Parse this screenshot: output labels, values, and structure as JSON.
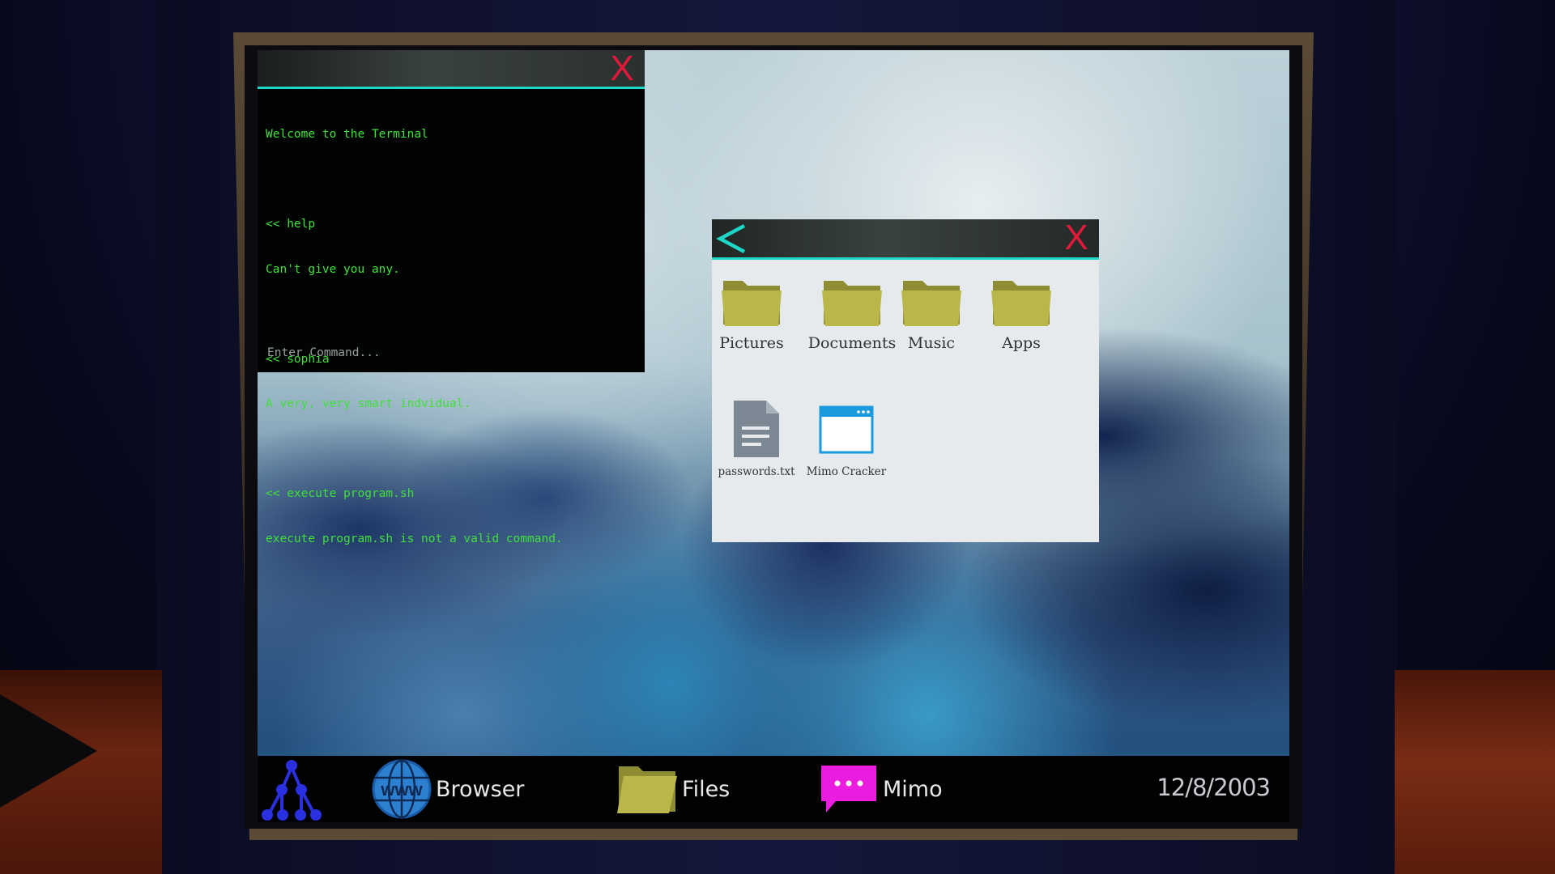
{
  "terminal": {
    "close_label": "X",
    "lines": [
      "Welcome to the Terminal",
      "",
      "<< help",
      "Can't give you any.",
      "",
      "<< sophia",
      "A very, very smart indvidual.",
      "",
      "<< execute program.sh",
      "execute program.sh is not a valid command."
    ],
    "input_placeholder": "Enter Command..."
  },
  "explorer": {
    "close_label": "X",
    "items": [
      {
        "label": "Pictures",
        "icon": "folder-icon"
      },
      {
        "label": "Documents",
        "icon": "folder-icon"
      },
      {
        "label": "Music",
        "icon": "folder-icon"
      },
      {
        "label": "Apps",
        "icon": "folder-icon"
      },
      {
        "label": "passwords.txt",
        "icon": "text-file-icon"
      },
      {
        "label": "Mimo Cracker",
        "icon": "app-window-icon"
      }
    ]
  },
  "taskbar": {
    "start_icon": "network-tree-icon",
    "buttons": [
      {
        "label": "Browser",
        "icon": "www-globe-icon"
      },
      {
        "label": "Files",
        "icon": "folder-icon"
      },
      {
        "label": "Mimo",
        "icon": "chat-bubble-icon"
      }
    ],
    "date": "12/8/2003"
  },
  "colors": {
    "terminal_text": "#3fe03a",
    "accent_cyan": "#1fd7c9",
    "close_red": "#e2193a",
    "folder_olive": "#b9b74a",
    "start_blue": "#2a2fe0",
    "mimo_magenta": "#e91ce0"
  }
}
